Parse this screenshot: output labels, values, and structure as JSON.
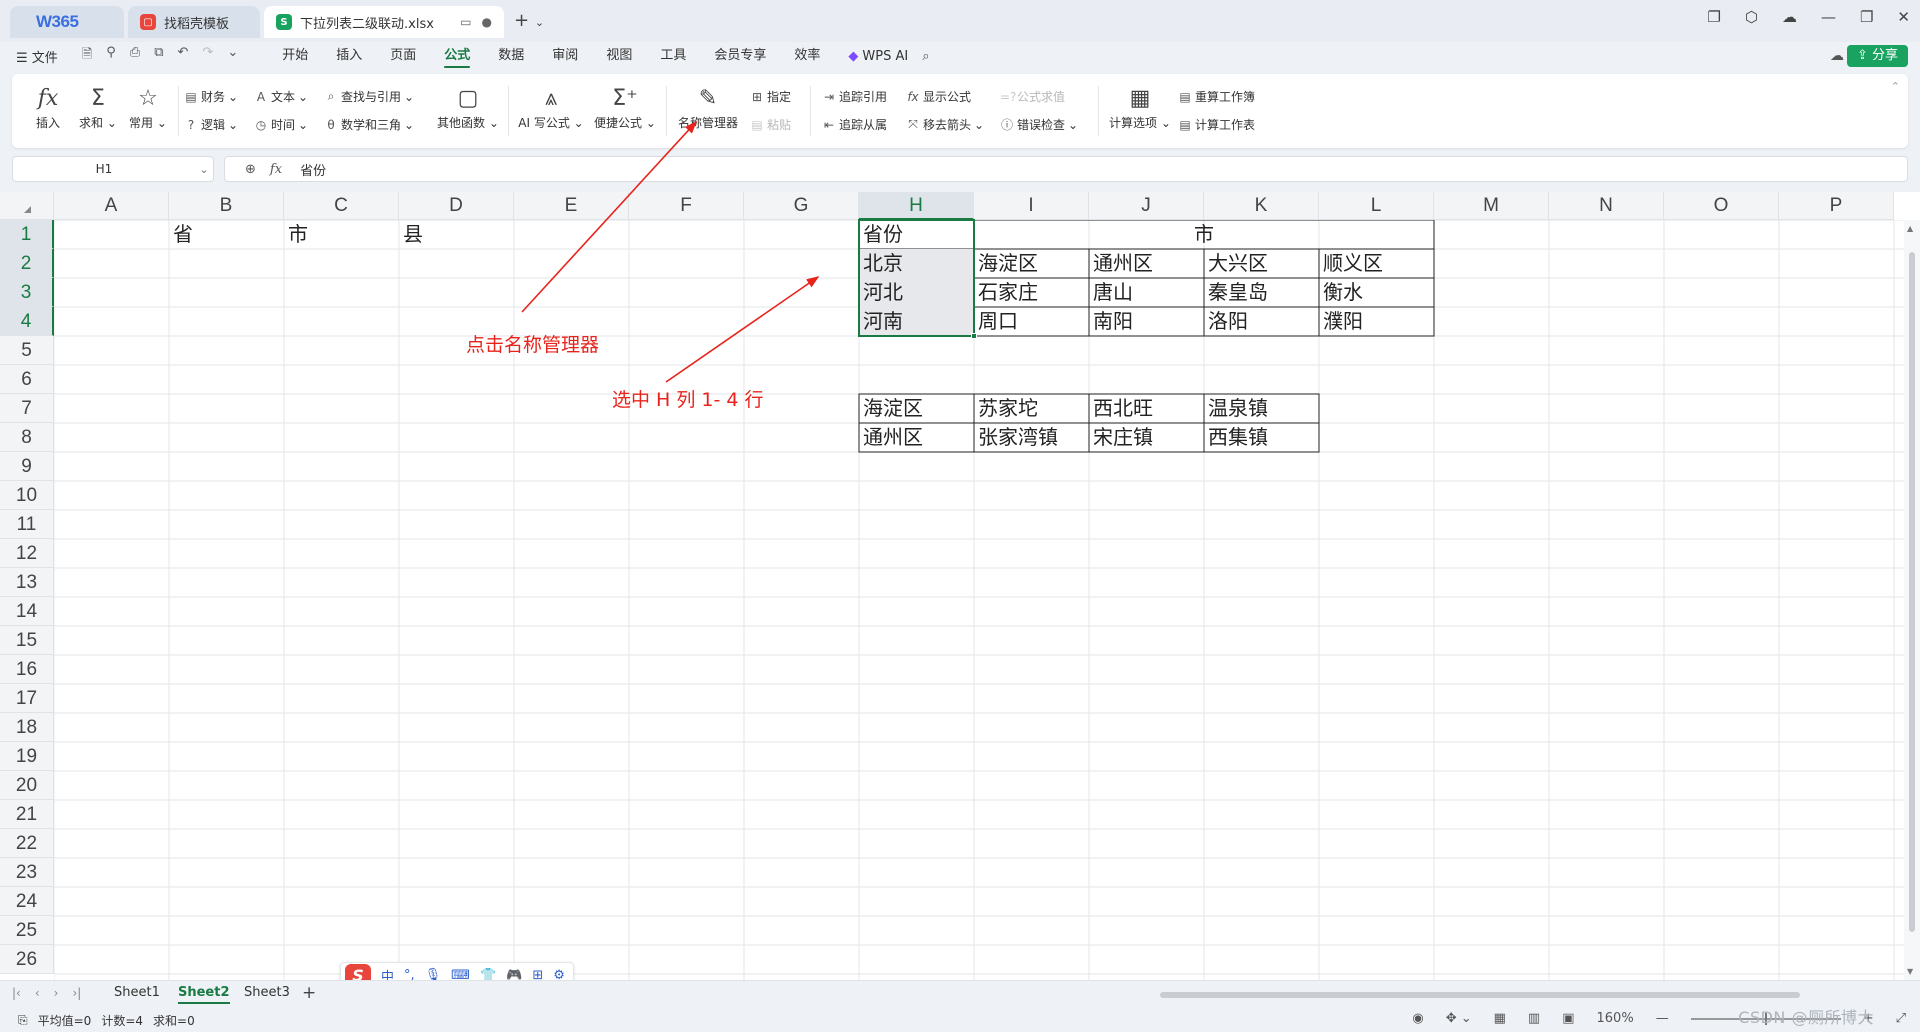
{
  "tabs": [
    {
      "label": "W365"
    },
    {
      "label": "找稻壳模板"
    },
    {
      "label": "下拉列表二级联动.xlsx"
    }
  ],
  "menu": {
    "file": "文件",
    "items": [
      "开始",
      "插入",
      "页面",
      "公式",
      "数据",
      "审阅",
      "视图",
      "工具",
      "会员专享",
      "效率"
    ],
    "active": "公式",
    "wps_ai": "WPS AI",
    "share": "分享"
  },
  "ribbon": {
    "insert": "插入",
    "sum": "求和",
    "common": "常用",
    "finance": "财务",
    "text": "文本",
    "lookup": "查找与引用",
    "logic": "逻辑",
    "time": "时间",
    "math": "数学和三角",
    "other": "其他函数",
    "ai_formula": "AI 写公式",
    "quick_formula": "便捷公式",
    "name_manager": "名称管理器",
    "define": "指定",
    "paste": "粘贴",
    "trace_precedents": "追踪引用",
    "show_formulas": "显示公式",
    "evaluate": "公式求值",
    "trace_dependents": "追踪从属",
    "remove_arrows": "移去箭头",
    "error_check": "错误检查",
    "calc_options": "计算选项",
    "recalc_workbook": "重算工作簿",
    "calc_sheet": "计算工作表"
  },
  "formula_bar": {
    "name_box": "H1",
    "fx": "fx",
    "value": "省份"
  },
  "columns": [
    "A",
    "B",
    "C",
    "D",
    "E",
    "F",
    "G",
    "H",
    "I",
    "J",
    "K",
    "L",
    "M",
    "N",
    "O",
    "P"
  ],
  "rows": [
    "1",
    "2",
    "3",
    "4",
    "5",
    "6",
    "7",
    "8",
    "9",
    "10",
    "11",
    "12",
    "13",
    "14",
    "15",
    "16",
    "17",
    "18",
    "19",
    "20",
    "21",
    "22",
    "23",
    "24",
    "25",
    "26"
  ],
  "cells": {
    "B1": "省",
    "C1": "市",
    "D1": "县",
    "H1": "省份",
    "I1": "市",
    "H2": "北京",
    "I2": "海淀区",
    "J2": "通州区",
    "K2": "大兴区",
    "L2": "顺义区",
    "H3": "河北",
    "I3": "石家庄",
    "J3": "唐山",
    "K3": "秦皇岛",
    "L3": "衡水",
    "H4": "河南",
    "I4": "周口",
    "J4": "南阳",
    "K4": "洛阳",
    "L4": "濮阳",
    "H7": "海淀区",
    "I7": "苏家坨",
    "J7": "西北旺",
    "K7": "温泉镇",
    "H8": "通州区",
    "I8": "张家湾镇",
    "J8": "宋庄镇",
    "K8": "西集镇"
  },
  "annotations": {
    "name_manager_note": "点击名称管理器",
    "select_note": "选中 H 列 1- 4 行",
    "color": "#e8231b"
  },
  "sheets": [
    "Sheet1",
    "Sheet2",
    "Sheet3"
  ],
  "active_sheet": "Sheet2",
  "ime": {
    "lang": "中"
  },
  "status": {
    "average": "平均值=0",
    "count": "计数=4",
    "sum": "求和=0",
    "zoom": "160%"
  },
  "watermark": "CSDN @厕所博大",
  "colors": {
    "accent": "#1a7a44",
    "share": "#1aa260",
    "selected_cell": "#e6e8eb"
  }
}
